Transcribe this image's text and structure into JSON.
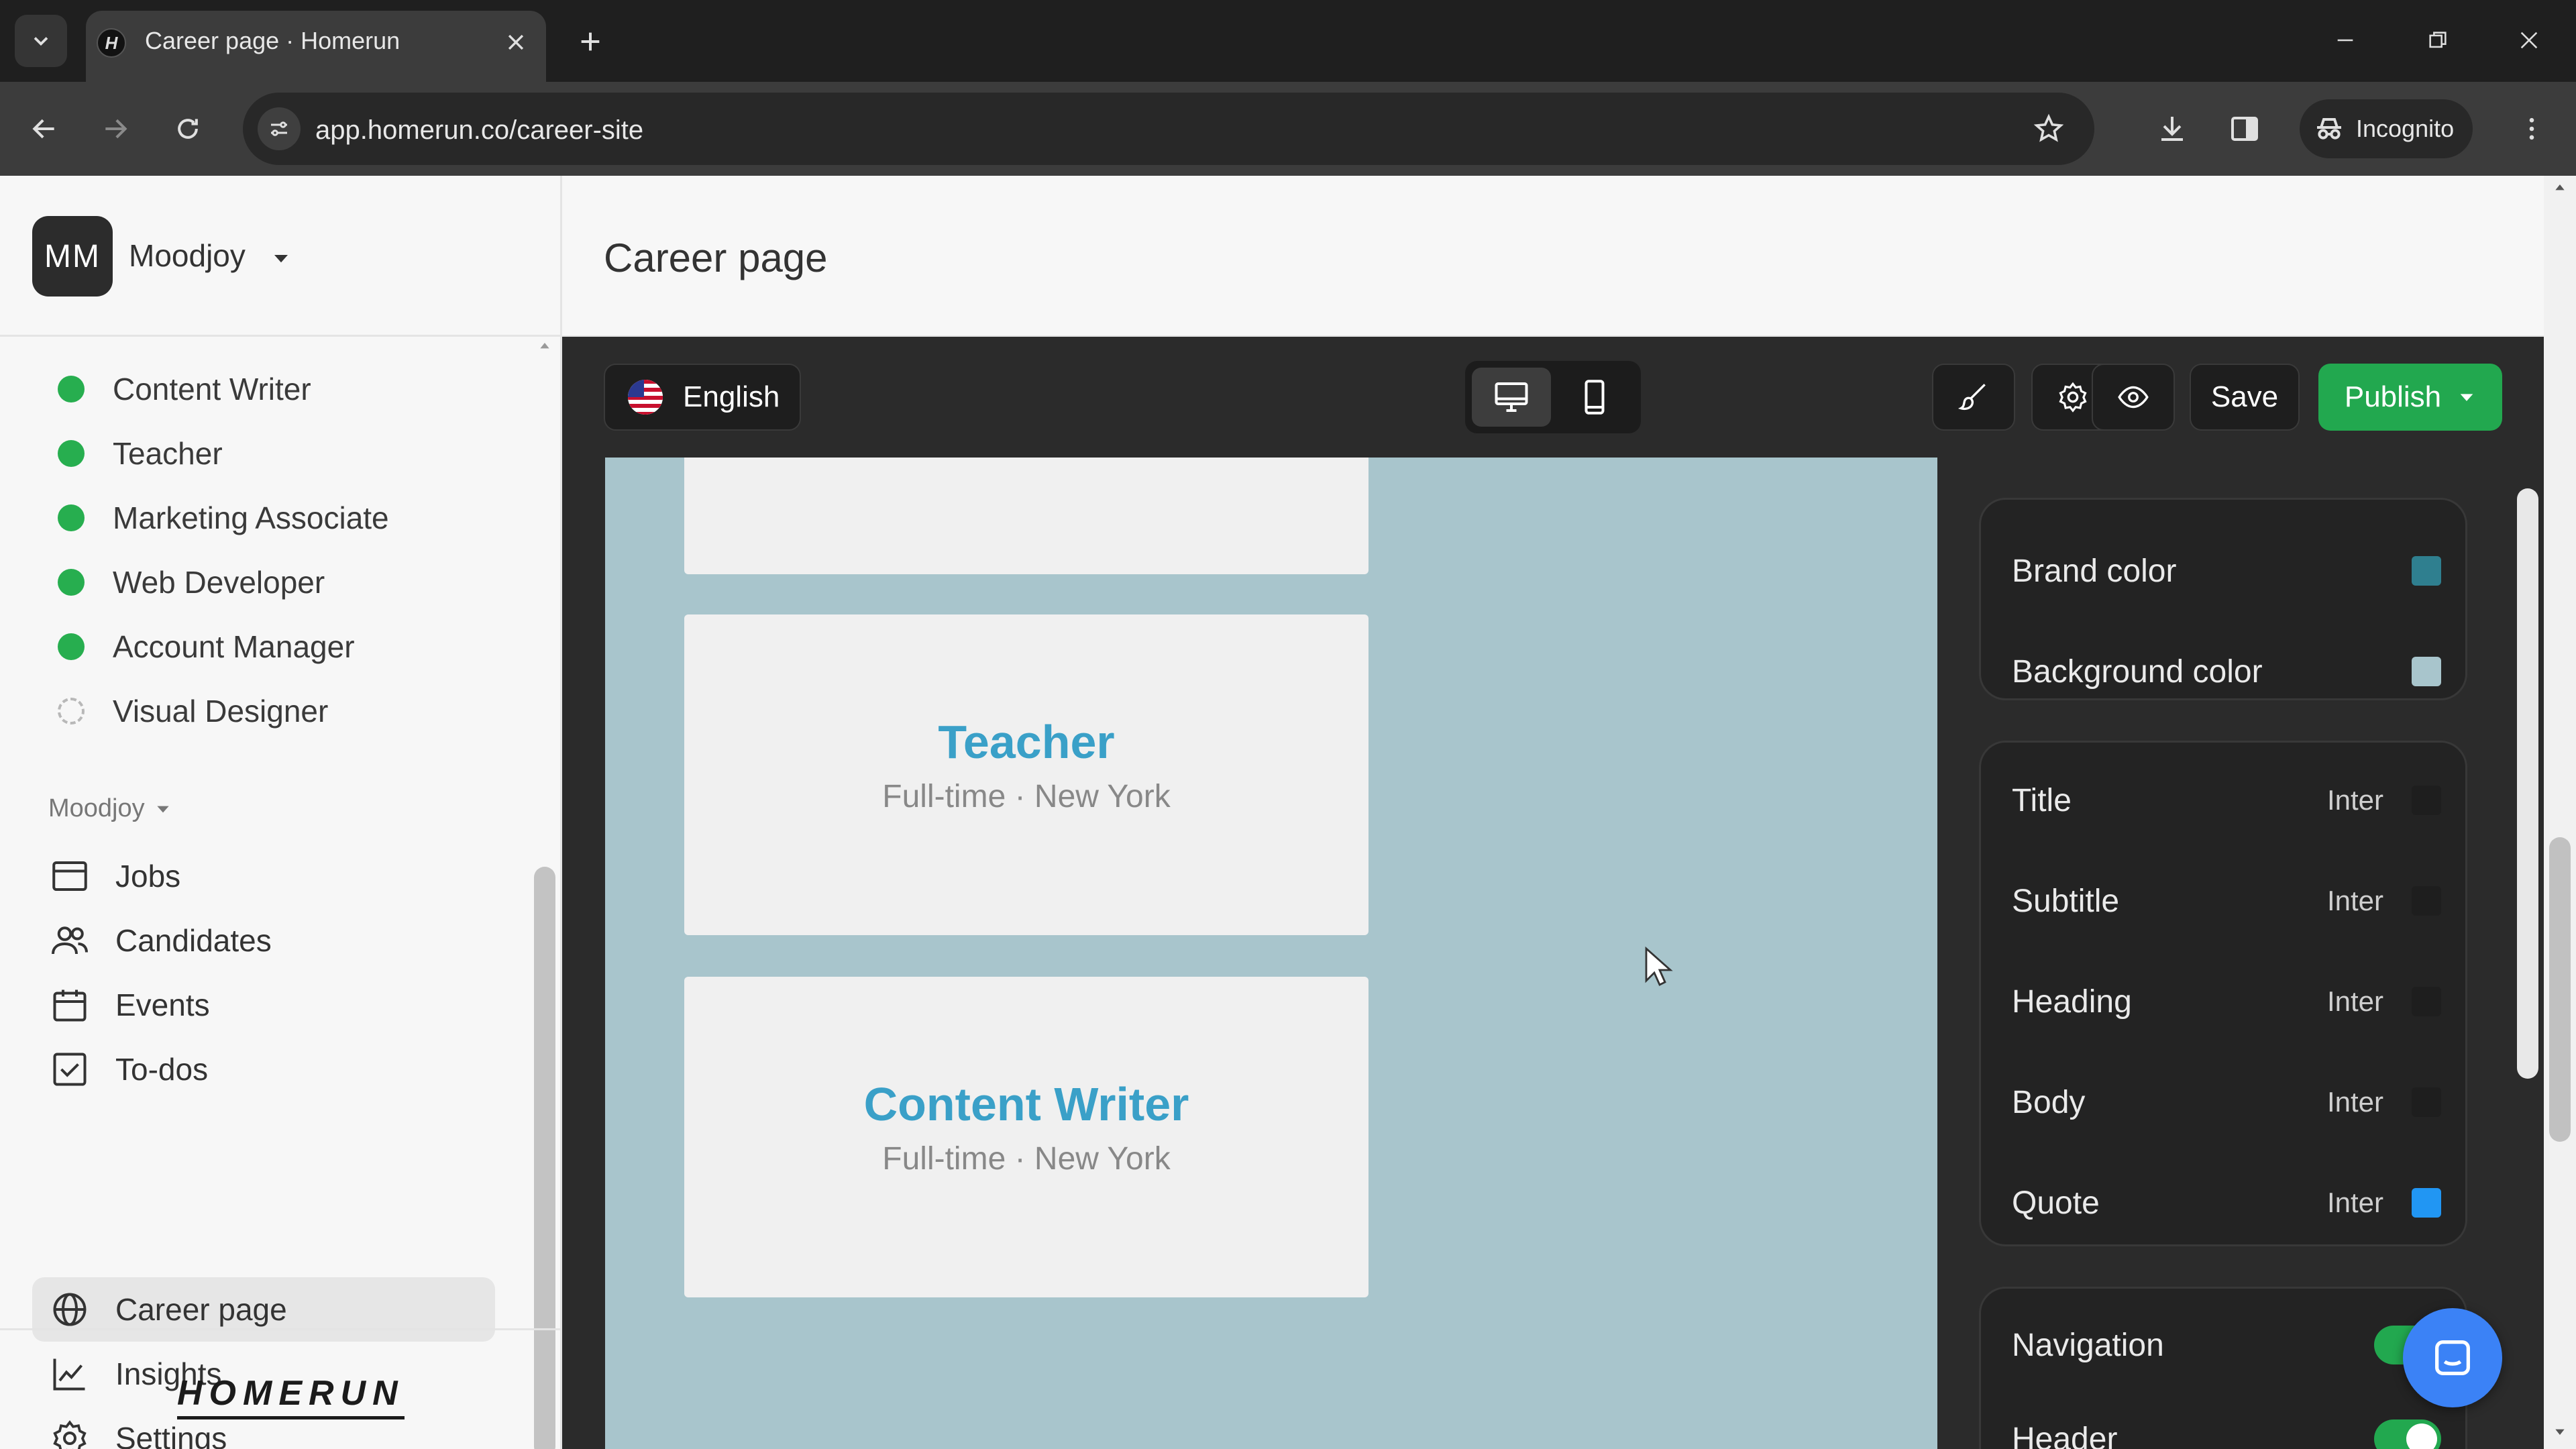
{
  "browser": {
    "tab_title": "Career page · Homerun",
    "favicon_letter": "H",
    "url": "app.homerun.co/career-site",
    "incognito_label": "Incognito"
  },
  "sidebar": {
    "avatar_initials": "MM",
    "org_name": "Moodjoy",
    "jobs": [
      {
        "label": "Content Writer",
        "status": "published"
      },
      {
        "label": "Teacher",
        "status": "published"
      },
      {
        "label": "Marketing Associate",
        "status": "published"
      },
      {
        "label": "Web Developer",
        "status": "published"
      },
      {
        "label": "Account Manager",
        "status": "published"
      },
      {
        "label": "Visual Designer",
        "status": "draft"
      }
    ],
    "section_label": "Moodjoy",
    "nav": [
      {
        "label": "Jobs",
        "icon": "briefcase-icon"
      },
      {
        "label": "Candidates",
        "icon": "people-icon"
      },
      {
        "label": "Events",
        "icon": "calendar-icon"
      },
      {
        "label": "To-dos",
        "icon": "checkbox-icon"
      },
      {
        "label": "Career page",
        "icon": "globe-icon",
        "active": true
      },
      {
        "label": "Insights",
        "icon": "chart-line-icon"
      },
      {
        "label": "Settings",
        "icon": "gear-icon"
      }
    ],
    "logo_text": "HOMERUN"
  },
  "main": {
    "page_title": "Career page",
    "language": "English",
    "save_label": "Save",
    "publish_label": "Publish"
  },
  "preview": {
    "cards": [
      {
        "title": "Teacher",
        "meta": "Full-time · New York"
      },
      {
        "title": "Content Writer",
        "meta": "Full-time · New York"
      }
    ]
  },
  "design_panel": {
    "colors": [
      {
        "label": "Brand color",
        "value": "#2f7f8f"
      },
      {
        "label": "Background color",
        "value": "#a8c5cc"
      }
    ],
    "fonts": [
      {
        "label": "Title",
        "font": "Inter",
        "color": "#1e1e1e"
      },
      {
        "label": "Subtitle",
        "font": "Inter",
        "color": "#1e1e1e"
      },
      {
        "label": "Heading",
        "font": "Inter",
        "color": "#1e1e1e"
      },
      {
        "label": "Body",
        "font": "Inter",
        "color": "#1e1e1e"
      },
      {
        "label": "Quote",
        "font": "Inter",
        "color": "#2196f3"
      }
    ],
    "toggles": [
      {
        "label": "Navigation",
        "on": true
      },
      {
        "label": "Header",
        "on": true
      }
    ]
  },
  "colors": {
    "accent_green": "#22a84f",
    "job_title_blue": "#3aa0c8"
  }
}
